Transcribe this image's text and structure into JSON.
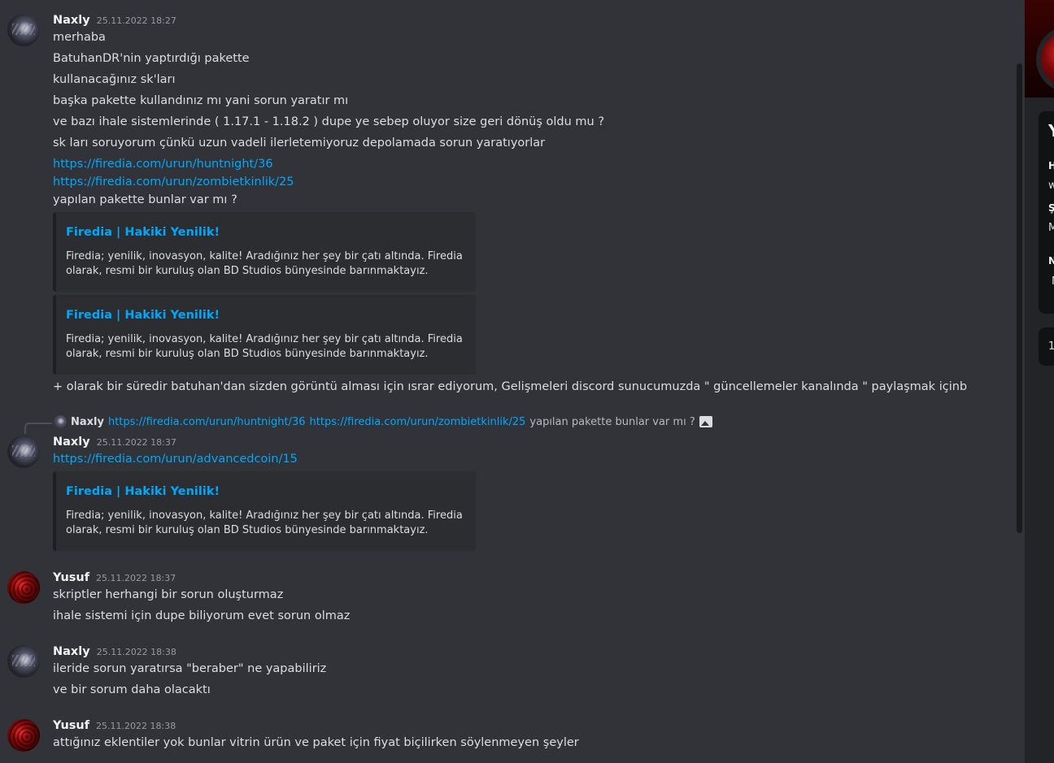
{
  "messages": [
    {
      "author": "Naxly",
      "timestamp": "25.11.2022 18:27",
      "lines": [
        "merhaba",
        "BatuhanDR'nin yaptırdığı pakette",
        "kullanacağınız sk'ları",
        "başka pakette kullandınız mı yani sorun yaratır mı",
        "ve bazı ihale sistemlerinde ( 1.17.1 - 1.18.2 ) dupe ye sebep oluyor size geri dönüş oldu mu ?",
        "sk ları soruyorum çünkü uzun vadeli ilerletemiyoruz depolamada sorun yaratıyorlar"
      ],
      "links": [
        "https://firedia.com/urun/huntnight/36",
        "https://firedia.com/urun/zombietkinlik/25"
      ],
      "after_links": "yapılan pakette bunlar var mı ?",
      "embeds": [
        {
          "title": "Firedia | Hakiki Yenilik!",
          "description": "Firedia; yenilik, inovasyon, kalite! Aradığınız her şey bir çatı altında. Firedia olarak, resmi bir kuruluş olan BD Studios bünyesinde barınmaktayız."
        },
        {
          "title": "Firedia | Hakiki Yenilik!",
          "description": "Firedia; yenilik, inovasyon, kalite! Aradığınız her şey bir çatı altında. Firedia olarak, resmi bir kuruluş olan BD Studios bünyesinde barınmaktayız."
        }
      ],
      "trailing": "+ olarak bir süredir batuhan'dan sizden görüntü alması için ısrar ediyorum, Gelişmeleri discord sunucumuzda \" güncellemeler kanalında \" paylaşmak içinb"
    },
    {
      "author": "Naxly",
      "timestamp": "25.11.2022 18:37",
      "reply": {
        "author": "Naxly",
        "link1": "https://firedia.com/urun/huntnight/36",
        "link2": "https://firedia.com/urun/zombietkinlik/25",
        "text": "yapılan pakette bunlar var mı ?"
      },
      "link": "https://firedia.com/urun/advancedcoin/15",
      "embed": {
        "title": "Firedia | Hakiki Yenilik!",
        "description": "Firedia; yenilik, inovasyon, kalite! Aradığınız her şey bir çatı altında. Firedia olarak, resmi bir kuruluş olan BD Studios bünyesinde barınmaktayız."
      }
    },
    {
      "author": "Yusuf",
      "timestamp": "25.11.2022 18:37",
      "lines": [
        "skriptler herhangi bir sorun oluşturmaz",
        "ihale sistemi için dupe biliyorum evet sorun olmaz"
      ]
    },
    {
      "author": "Naxly",
      "timestamp": "25.11.2022 18:38",
      "lines": [
        "ileride sorun yaratırsa \"beraber\" ne yapabiliriz",
        "ve bir sorum daha olacaktı"
      ]
    },
    {
      "author": "Yusuf",
      "timestamp": "25.11.2022 18:38",
      "lines": [
        "attığınız eklentiler yok bunlar vitrin ürün ve paket için fiyat biçilirken söylenmeyen şeyler"
      ]
    }
  ],
  "profile_panel": {
    "name_initial": "Y",
    "h1": "H",
    "v1": "w",
    "h2": "Ş",
    "v2": "M",
    "h3": "N",
    "v3": "N",
    "card2": "1"
  },
  "colors": {
    "background": "#313338",
    "link": "#00a8fc",
    "embed_bg": "#2b2d31",
    "sidebar": "#232428"
  }
}
